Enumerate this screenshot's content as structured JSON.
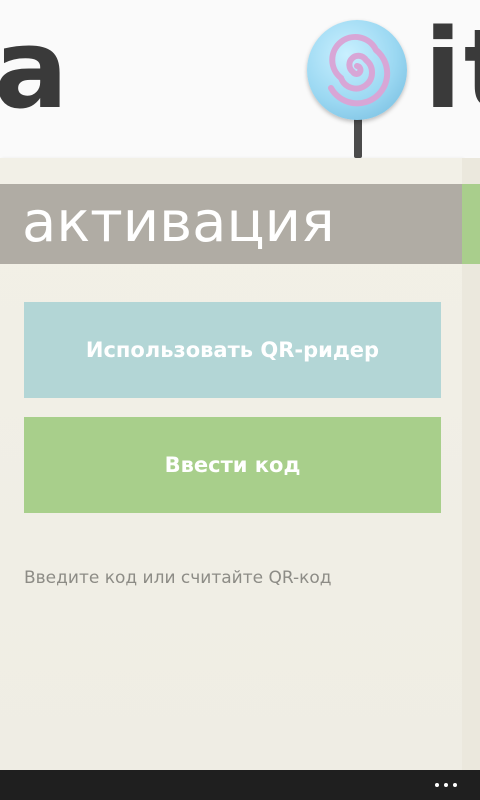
{
  "header": {
    "logo_left": "a",
    "logo_right": "it"
  },
  "page": {
    "title": "активация"
  },
  "buttons": {
    "qr_reader": "Использовать QR-ридер",
    "enter_code": "Ввести код"
  },
  "hint": "Введите код или считайте QR-код",
  "app_bar": {
    "more_icon": "ellipsis-icon"
  },
  "colors": {
    "title_band": "#b0aca4",
    "qr_button": "#b3d6d6",
    "code_button": "#a8cf8b",
    "app_bar": "#1f1f1f"
  }
}
